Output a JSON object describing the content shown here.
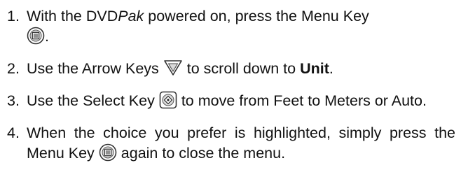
{
  "steps": [
    {
      "number": "1.",
      "text_a": "With the DVD",
      "text_a_italic": "Pak",
      "text_b": " powered on, press the Menu Key",
      "icon": "menu-key-icon",
      "text_c": "."
    },
    {
      "number": "2.",
      "text_a": "Use the Arrow Keys",
      "icon": "arrow-down-key-icon",
      "text_b": "to scroll down to ",
      "text_bold": "Unit",
      "text_c": "."
    },
    {
      "number": "3.",
      "text_a": "Use the Select Key",
      "icon": "select-key-icon",
      "text_b": "to move from Feet to Meters or Auto."
    },
    {
      "number": "4.",
      "text_a": "When the choice you prefer is highlighted, simply press the Menu Key",
      "icon": "menu-key-icon",
      "text_b": "again to close the menu."
    }
  ]
}
